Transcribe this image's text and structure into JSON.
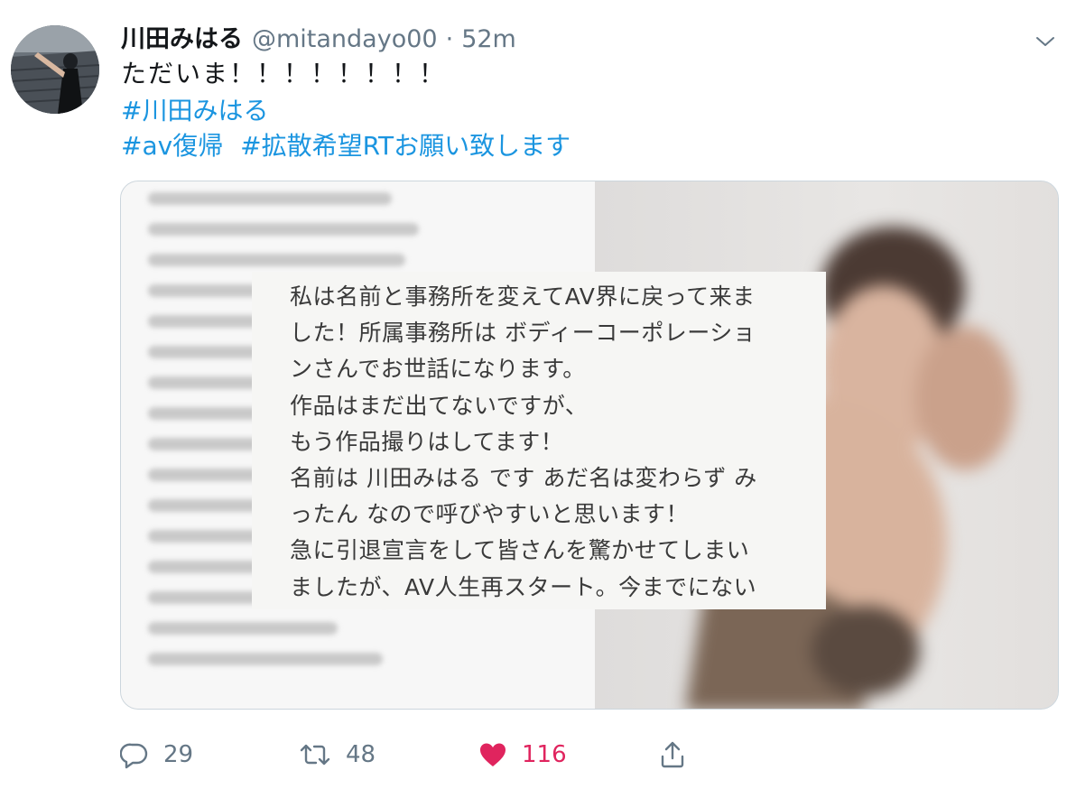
{
  "header": {
    "display_name": "川田みはる",
    "username": "@mitandayo00",
    "separator": "·",
    "timestamp": "52m"
  },
  "icons": {
    "avatar": "avatar-photo",
    "caret": "chevron-down-icon",
    "reply": "reply-icon",
    "retweet": "retweet-icon",
    "like": "heart-icon",
    "share": "share-icon"
  },
  "tweet": {
    "text": "ただいま！！！！！！！！",
    "hashtag_line1": [
      "#川田みはる"
    ],
    "hashtag_line2": [
      "#av復帰",
      "#拡散希望RTお願い致します"
    ]
  },
  "media": {
    "overlay_lines": [
      "私は名前と事務所を変えてAV界に戻って来ま",
      "した！所属事務所は ボディーコーポレーショ",
      "ンさんでお世話になります。",
      "作品はまだ出てないですが、",
      "もう作品撮りはしてます！",
      "名前は 川田みはる です あだ名は変わらず み",
      "ったん なので呼びやすいと思います！",
      "急に引退宣言をして皆さんを驚かせてしまい",
      "ましたが、AV人生再スタート。今までにない"
    ]
  },
  "actions": {
    "reply_count": "29",
    "retweet_count": "48",
    "like_count": "116"
  },
  "colors": {
    "text": "#14171a",
    "secondary": "#657786",
    "link": "#1b95e0",
    "like": "#e0245e",
    "border": "#ccd6dd"
  }
}
